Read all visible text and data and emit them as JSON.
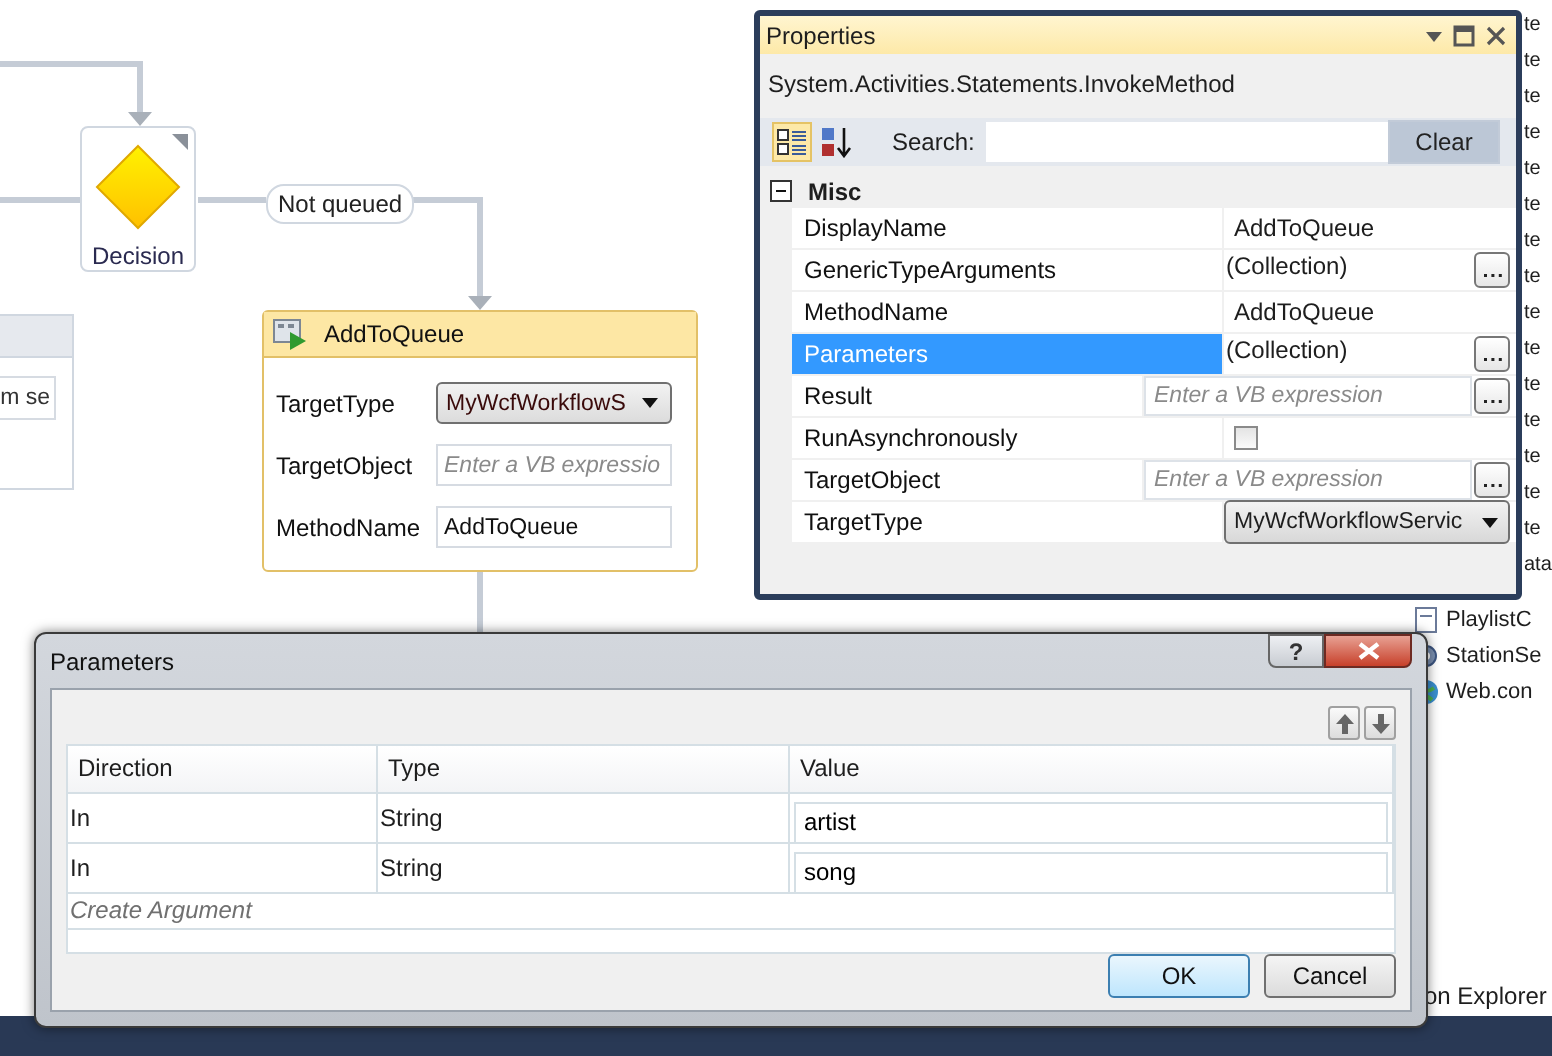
{
  "designer": {
    "decision": {
      "label": "Decision"
    },
    "connector_label": "Not queued",
    "partial_activity": {
      "field_value": "m se"
    },
    "activity": {
      "title": "AddToQueue",
      "fields": [
        {
          "label": "TargetType",
          "kind": "dropdown",
          "value": "MyWcfWorkflowS"
        },
        {
          "label": "TargetObject",
          "kind": "expression",
          "placeholder": "Enter a VB expressio"
        },
        {
          "label": "MethodName",
          "kind": "text",
          "value": "AddToQueue"
        }
      ]
    }
  },
  "properties": {
    "title": "Properties",
    "subtitle": "System.Activities.Statements.InvokeMethod",
    "view_buttons": [
      {
        "kind": "categorized",
        "selected": true
      },
      {
        "kind": "alphabetical",
        "selected": false
      }
    ],
    "search_label": "Search:",
    "clear_button": "Clear",
    "category": {
      "label": "Misc",
      "expanded": true
    },
    "rows": [
      {
        "name": "DisplayName",
        "kind": "text",
        "value": "AddToQueue",
        "selected": false
      },
      {
        "name": "GenericTypeArguments",
        "kind": "collection",
        "value": "(Collection)",
        "selected": false
      },
      {
        "name": "MethodName",
        "kind": "text",
        "value": "AddToQueue",
        "selected": false
      },
      {
        "name": "Parameters",
        "kind": "collection",
        "value": "(Collection)",
        "selected": true
      },
      {
        "name": "Result",
        "kind": "expression",
        "placeholder": "Enter a VB expression",
        "selected": false
      },
      {
        "name": "RunAsynchronously",
        "kind": "checkbox",
        "checked": false,
        "selected": false
      },
      {
        "name": "TargetObject",
        "kind": "expression",
        "placeholder": "Enter a VB expression",
        "selected": false
      },
      {
        "name": "TargetType",
        "kind": "dropdown",
        "value": "MyWcfWorkflowServic",
        "selected": false
      }
    ]
  },
  "solution_explorer": {
    "fragments": [
      "te",
      "te",
      "te",
      "te",
      "te",
      "te",
      "te",
      "te",
      "te",
      "te",
      "te",
      "te",
      "te",
      "te",
      "te",
      "ata"
    ],
    "items": [
      {
        "label": "PlaylistC",
        "kind": "code"
      },
      {
        "label": "StationSe",
        "kind": "service"
      },
      {
        "label": "Web.con",
        "kind": "config"
      }
    ],
    "tab_label": "on Explorer"
  },
  "parameters_dialog": {
    "title": "Parameters",
    "help_glyph": "?",
    "columns": [
      "Direction",
      "Type",
      "Value"
    ],
    "rows": [
      {
        "direction": "In",
        "type": "String",
        "value": "artist"
      },
      {
        "direction": "In",
        "type": "String",
        "value": "song"
      }
    ],
    "add_row_label": "Create Argument",
    "buttons": [
      {
        "label": "OK",
        "default": true
      },
      {
        "label": "Cancel",
        "default": false
      }
    ]
  }
}
